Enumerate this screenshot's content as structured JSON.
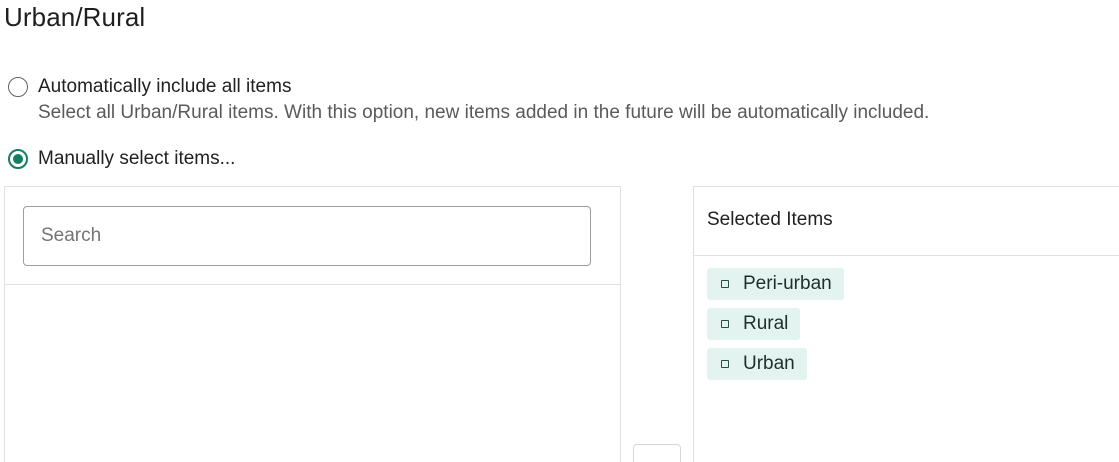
{
  "title": "Urban/Rural",
  "options": {
    "auto": {
      "label": "Automatically include all items",
      "help": "Select all Urban/Rural items. With this option, new items added in the future will be automatically included.",
      "checked": false
    },
    "manual": {
      "label": "Manually select items...",
      "checked": true
    }
  },
  "search": {
    "placeholder": "Search",
    "value": ""
  },
  "selected": {
    "header": "Selected Items",
    "items": [
      "Peri-urban",
      "Rural",
      "Urban"
    ]
  },
  "colors": {
    "accent": "#147d64",
    "chip_bg": "#e3f3f0"
  }
}
